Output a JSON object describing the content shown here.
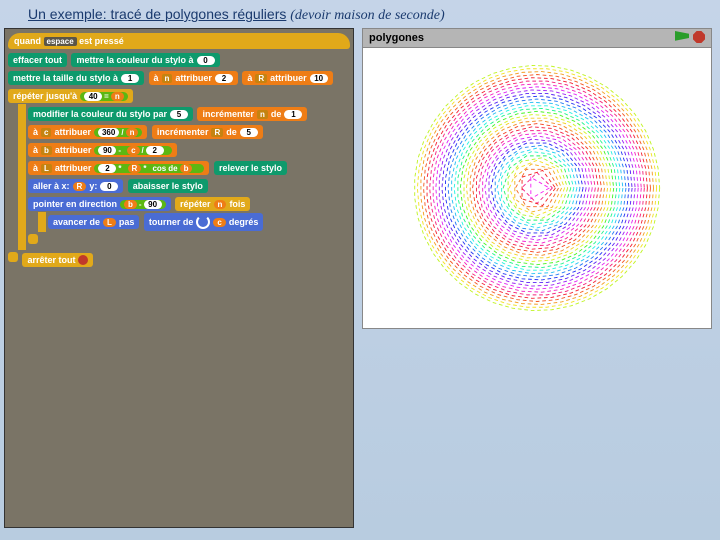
{
  "title_main": "Un exemple: tracé de polygones réguliers",
  "title_sub": "(devoir maison de seconde)",
  "stage": {
    "title": "polygones"
  },
  "blocks": {
    "when": "quand",
    "space": "espace",
    "pressed": "est pressé",
    "clear": "effacer tout",
    "pen_color_to": "mettre la couleur du stylo à",
    "pen_size_to": "mettre la taille du stylo à",
    "to": "à",
    "attribute": "attribuer",
    "repeat_until": "répéter jusqu'à",
    "change_pen_color": "modifier la couleur du stylo par",
    "increment": "incrémenter",
    "by": "de",
    "pen_up": "relever le stylo",
    "goto": "aller à x:",
    "goto_y": "y:",
    "pen_down": "abaisser le stylo",
    "point_dir": "pointer en direction",
    "repeat": "répéter",
    "times": "fois",
    "move": "avancer de",
    "steps": "pas",
    "turn": "tourner de",
    "degrees": "degrés",
    "stop_all": "arrêter tout",
    "cos": "cos",
    "of": "de"
  },
  "vals": {
    "zero": "0",
    "one": "1",
    "two": "2",
    "five": "5",
    "ten": "10",
    "forty": "40",
    "ninety": "90",
    "three_sixty": "360"
  },
  "vars": {
    "n": "n",
    "R": "R",
    "c": "c",
    "b": "b",
    "L": "L"
  },
  "ops": {
    "eq": "=",
    "div": "/",
    "mul": "*",
    "sub": "-"
  }
}
